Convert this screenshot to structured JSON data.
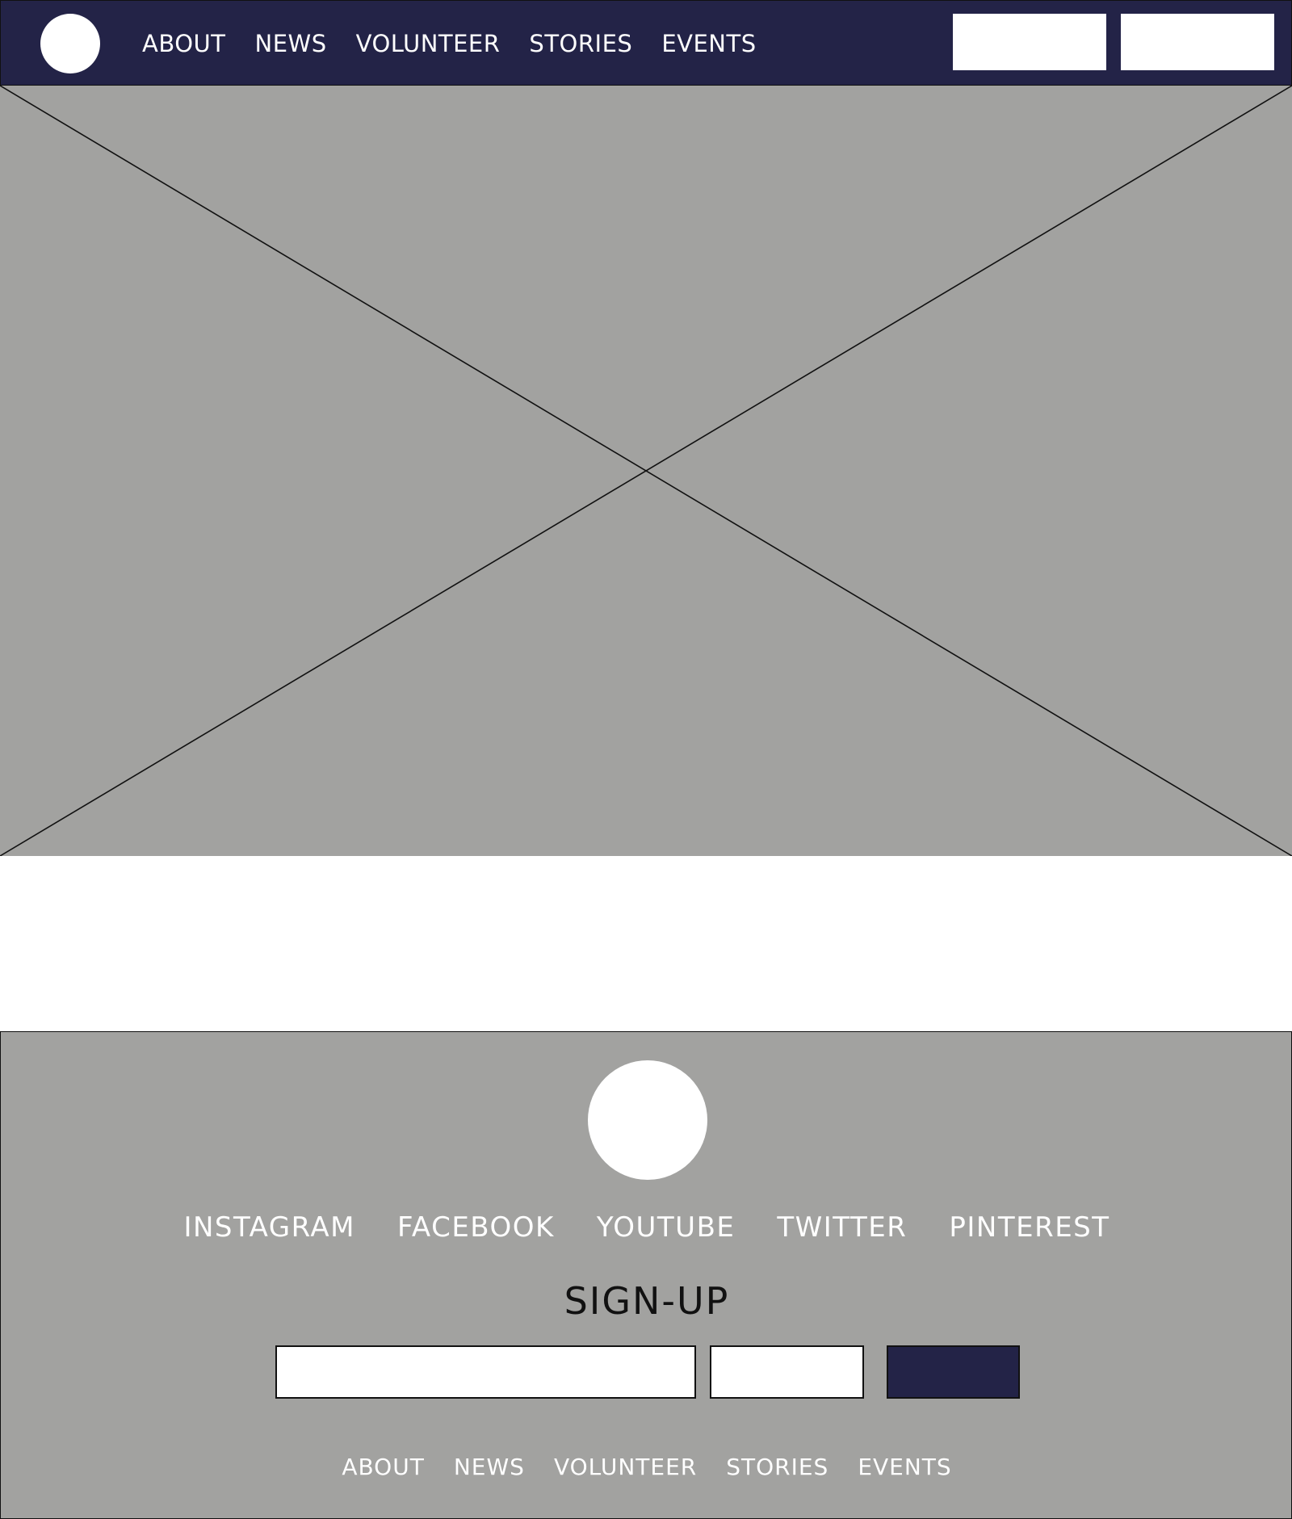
{
  "colors": {
    "header_bg": "#232347",
    "placeholder_gray": "#a2a2a0",
    "white": "#ffffff",
    "submit_button": "#232347"
  },
  "header": {
    "logo": "circle-logo",
    "nav": [
      "ABOUT",
      "NEWS",
      "VOLUNTEER",
      "STORIES",
      "EVENTS"
    ],
    "buttons": [
      "",
      ""
    ]
  },
  "hero": {
    "type": "image-placeholder",
    "icon": "crossed-box-placeholder"
  },
  "footer": {
    "logo": "circle-logo",
    "social": [
      "INSTAGRAM",
      "FACEBOOK",
      "YOUTUBE",
      "TWITTER",
      "PINTEREST"
    ],
    "signup_title": "SIGN-UP",
    "signup_fields": [
      {
        "value": "",
        "placeholder": ""
      },
      {
        "value": "",
        "placeholder": ""
      }
    ],
    "submit_label": "",
    "nav": [
      "ABOUT",
      "NEWS",
      "VOLUNTEER",
      "STORIES",
      "EVENTS"
    ]
  }
}
